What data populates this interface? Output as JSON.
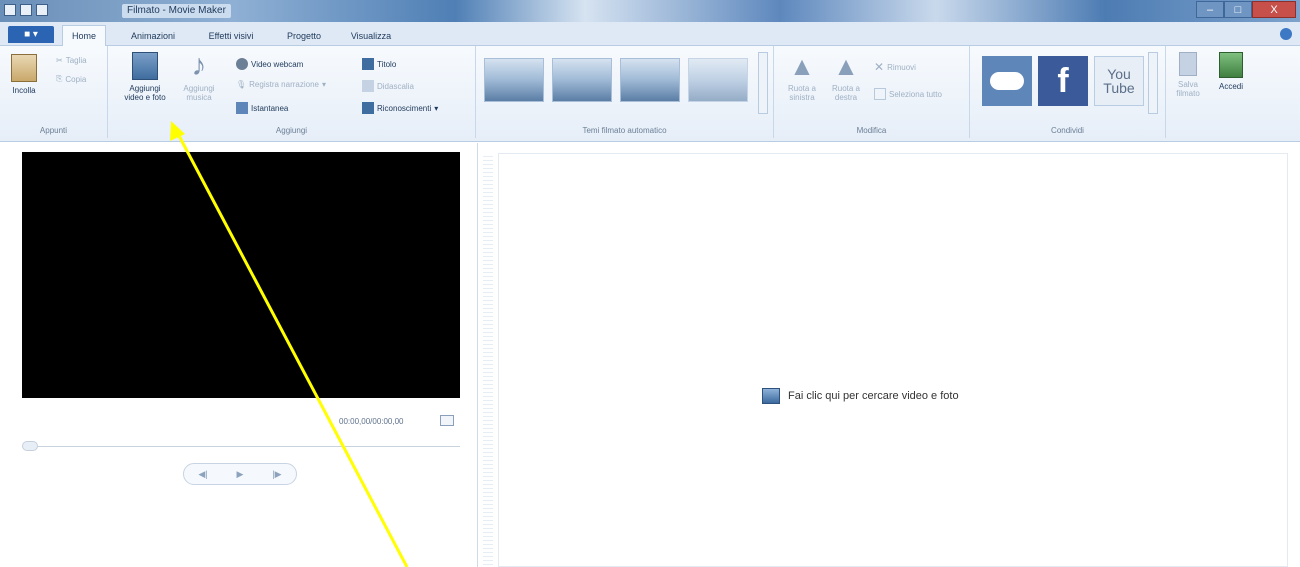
{
  "window": {
    "title": "Filmato - Movie Maker",
    "controls": {
      "min": "–",
      "max": "□",
      "close": "X"
    }
  },
  "tabs": {
    "file": "■ ▾",
    "items": [
      "Home",
      "Animazioni",
      "Effetti visivi",
      "Progetto",
      "Visualizza"
    ]
  },
  "ribbon": {
    "clipboard": {
      "paste": "Incolla",
      "cut": "Taglia",
      "copy": "Copia",
      "group": "Appunti"
    },
    "add": {
      "add_video_line1": "Aggiungi",
      "add_video_line2": "video e foto",
      "add_music_line1": "Aggiungi",
      "add_music_line2": "musica",
      "webcam": "Video webcam",
      "narration": "Registra narrazione",
      "snapshot": "Istantanea",
      "title": "Titolo",
      "caption": "Didascalia",
      "credits": "Riconoscimenti",
      "group": "Aggiungi"
    },
    "themes": {
      "group": "Temi filmato automatico"
    },
    "edit": {
      "rotate_left_1": "Ruota a",
      "rotate_left_2": "sinistra",
      "rotate_right_1": "Ruota a",
      "rotate_right_2": "destra",
      "remove": "Rimuovi",
      "select_all": "Seleziona tutto",
      "group": "Modifica"
    },
    "share": {
      "youtube_1": "You",
      "youtube_2": "Tube",
      "save_movie_1": "Salva",
      "save_movie_2": "filmato",
      "signin": "Accedi",
      "group": "Condividi"
    }
  },
  "preview": {
    "timecode": "00:00,00/00:00,00"
  },
  "storyboard": {
    "hint": "Fai clic qui per cercare video e foto"
  },
  "colors": {
    "annotation_arrow": "#ffff00"
  }
}
